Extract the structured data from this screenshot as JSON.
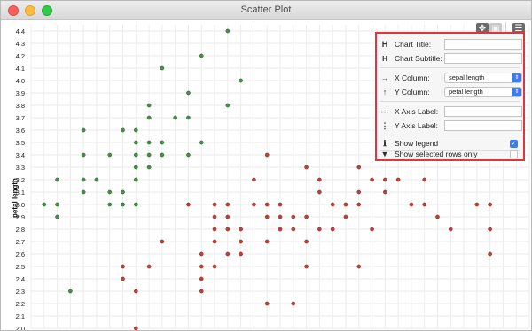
{
  "window": {
    "title": "Scatter Plot"
  },
  "toolbar": {
    "move_icon": "move-icon",
    "select_icon": "select-icon",
    "menu_icon": "menu-icon"
  },
  "panel": {
    "chart_title_label": "Chart Title:",
    "chart_subtitle_label": "Chart Subtitle:",
    "x_column_label": "X Column:",
    "x_column_value": "sepal length",
    "y_column_label": "Y Column:",
    "y_column_value": "petal length",
    "x_axis_label_label": "X Axis Label:",
    "y_axis_label_label": "Y Axis Label:",
    "show_legend_label": "Show legend",
    "show_legend_checked": true,
    "show_selected_label": "Show selected rows only",
    "show_selected_checked": false
  },
  "chart_data": {
    "type": "scatter",
    "ylabel": "petal length",
    "yticks": [
      "2.0",
      "2.1",
      "2.2",
      "2.3",
      "2.4",
      "2.5",
      "2.6",
      "2.7",
      "2.8",
      "2.9",
      "3.0",
      "3.1",
      "3.2",
      "3.3",
      "3.4",
      "3.5",
      "3.6",
      "3.7",
      "3.8",
      "3.9",
      "4.0",
      "4.1",
      "4.2",
      "4.3",
      "4.4"
    ],
    "ylim": [
      2.0,
      4.45
    ],
    "xlim": [
      4.2,
      8.0
    ],
    "grid": true,
    "series": [
      {
        "color": "#3a9a3a",
        "points": [
          [
            4.3,
            3.0
          ],
          [
            4.4,
            3.0
          ],
          [
            4.4,
            2.9
          ],
          [
            4.4,
            3.2
          ],
          [
            4.5,
            2.3
          ],
          [
            4.6,
            3.1
          ],
          [
            4.6,
            3.2
          ],
          [
            4.6,
            3.4
          ],
          [
            4.6,
            3.6
          ],
          [
            4.7,
            3.2
          ],
          [
            4.8,
            3.0
          ],
          [
            4.8,
            3.1
          ],
          [
            4.8,
            3.4
          ],
          [
            4.9,
            3.0
          ],
          [
            4.9,
            3.1
          ],
          [
            4.9,
            3.6
          ],
          [
            5.0,
            3.0
          ],
          [
            5.0,
            3.2
          ],
          [
            5.0,
            3.3
          ],
          [
            5.0,
            3.4
          ],
          [
            5.0,
            3.5
          ],
          [
            5.0,
            3.6
          ],
          [
            5.1,
            3.3
          ],
          [
            5.1,
            3.4
          ],
          [
            5.1,
            3.5
          ],
          [
            5.1,
            3.7
          ],
          [
            5.1,
            3.8
          ],
          [
            5.2,
            3.4
          ],
          [
            5.2,
            3.5
          ],
          [
            5.2,
            4.1
          ],
          [
            5.3,
            3.7
          ],
          [
            5.4,
            3.4
          ],
          [
            5.4,
            3.7
          ],
          [
            5.4,
            3.9
          ],
          [
            5.5,
            3.5
          ],
          [
            5.5,
            4.2
          ],
          [
            5.7,
            3.8
          ],
          [
            5.7,
            4.4
          ],
          [
            5.8,
            4.0
          ]
        ]
      },
      {
        "color": "#d23a2a",
        "points": [
          [
            4.9,
            2.4
          ],
          [
            4.9,
            2.5
          ],
          [
            5.0,
            2.0
          ],
          [
            5.0,
            2.3
          ],
          [
            5.1,
            2.5
          ],
          [
            5.2,
            2.7
          ],
          [
            5.4,
            3.0
          ],
          [
            5.5,
            2.3
          ],
          [
            5.5,
            2.4
          ],
          [
            5.5,
            2.5
          ],
          [
            5.5,
            2.6
          ],
          [
            5.6,
            2.5
          ],
          [
            5.6,
            2.7
          ],
          [
            5.6,
            2.8
          ],
          [
            5.6,
            2.9
          ],
          [
            5.6,
            3.0
          ],
          [
            5.7,
            2.6
          ],
          [
            5.7,
            2.8
          ],
          [
            5.7,
            2.9
          ],
          [
            5.7,
            3.0
          ],
          [
            5.8,
            2.6
          ],
          [
            5.8,
            2.7
          ],
          [
            5.8,
            2.8
          ],
          [
            5.9,
            3.0
          ],
          [
            5.9,
            3.2
          ],
          [
            6.0,
            2.2
          ],
          [
            6.0,
            2.7
          ],
          [
            6.0,
            2.9
          ],
          [
            6.0,
            3.0
          ],
          [
            6.0,
            3.4
          ],
          [
            6.1,
            2.8
          ],
          [
            6.1,
            2.9
          ],
          [
            6.1,
            3.0
          ],
          [
            6.2,
            2.2
          ],
          [
            6.2,
            2.8
          ],
          [
            6.2,
            2.9
          ],
          [
            6.3,
            2.5
          ],
          [
            6.3,
            2.7
          ],
          [
            6.3,
            2.9
          ],
          [
            6.3,
            3.3
          ],
          [
            6.4,
            2.8
          ],
          [
            6.4,
            3.1
          ],
          [
            6.4,
            3.2
          ],
          [
            6.5,
            2.8
          ],
          [
            6.5,
            3.0
          ],
          [
            6.6,
            2.9
          ],
          [
            6.6,
            3.0
          ],
          [
            6.7,
            2.5
          ],
          [
            6.7,
            3.0
          ],
          [
            6.7,
            3.1
          ],
          [
            6.7,
            3.3
          ],
          [
            6.8,
            2.8
          ],
          [
            6.8,
            3.2
          ],
          [
            6.9,
            3.1
          ],
          [
            6.9,
            3.2
          ],
          [
            7.0,
            3.2
          ],
          [
            7.1,
            3.0
          ],
          [
            7.2,
            3.0
          ],
          [
            7.2,
            3.2
          ],
          [
            7.3,
            2.9
          ],
          [
            7.4,
            2.8
          ],
          [
            7.6,
            3.0
          ],
          [
            7.7,
            2.6
          ],
          [
            7.7,
            2.8
          ],
          [
            7.7,
            3.0
          ]
        ]
      }
    ]
  }
}
